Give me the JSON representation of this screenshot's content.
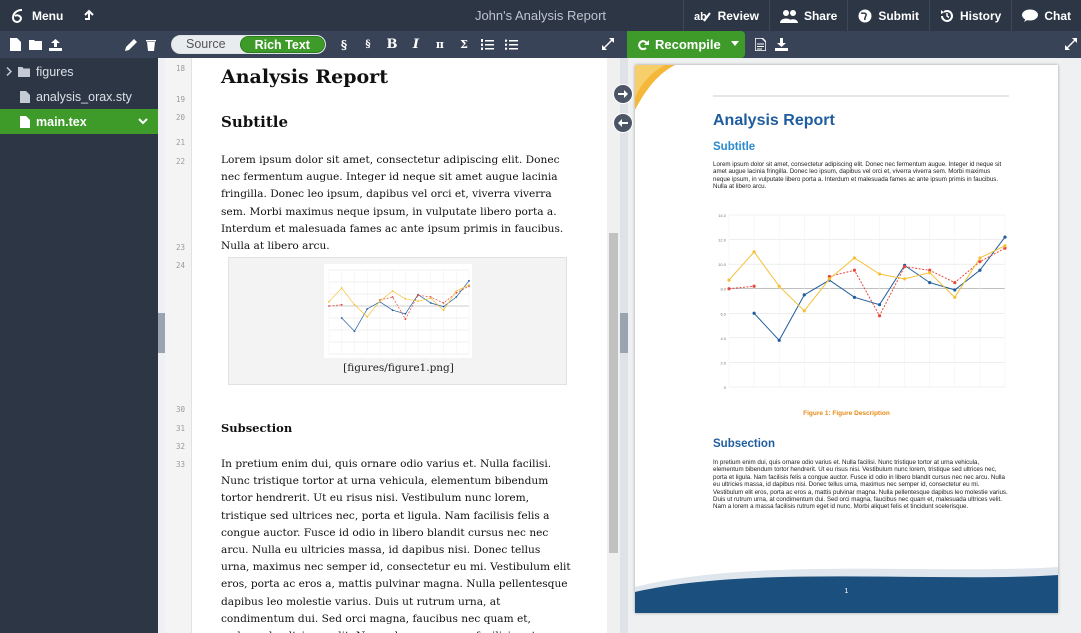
{
  "topbar": {
    "menu_label": "Menu",
    "title": "John's Analysis Report",
    "review_label": "Review",
    "share_label": "Share",
    "submit_label": "Submit",
    "history_label": "History",
    "chat_label": "Chat"
  },
  "toolbar": {
    "mode_source": "Source",
    "mode_rich": "Rich Text",
    "recompile_label": "Recompile"
  },
  "files": [
    {
      "name": "figures",
      "type": "folder"
    },
    {
      "name": "analysis_orax.sty",
      "type": "file"
    },
    {
      "name": "main.tex",
      "type": "file",
      "selected": true
    }
  ],
  "editor": {
    "line_numbers": {
      "title": "18",
      "blank_a": "19",
      "subtitle": "20",
      "blank_b": "21",
      "para1": "22",
      "blank_c": "23",
      "figure": "24",
      "blank_d": "30",
      "subsection": "31",
      "blank_e": "32",
      "para2": "33"
    },
    "title": "Analysis Report",
    "subtitle": "Subtitle",
    "para1": "Lorem ipsum dolor sit amet, consectetur adipiscing elit. Donec nec fermentum augue. Integer id neque sit amet augue lacinia fringilla. Donec leo ipsum, dapibus vel orci et, viverra viverra sem. Morbi maximus neque ipsum, in vulputate libero porta a. Interdum et malesuada fames ac ante ipsum primis in faucibus. Nulla at libero arcu.",
    "figure_path": "[figures/figure1.png]",
    "subsection": "Subsection",
    "para2": "In pretium enim dui, quis ornare odio varius et. Nulla facilisi. Nunc tristique tortor at urna vehicula, elementum bibendum tortor hendrerit. Ut eu risus nisi. Vestibulum nunc lorem, tristique sed ultrices nec, porta et ligula. Nam facilisis felis a congue auctor. Fusce id odio in libero blandit cursus nec nec arcu. Nulla eu ultricies massa, id dapibus nisi. Donec tellus urna, maximus nec semper id, consectetur eu mi. Vestibulum elit eros, porta ac eros a, mattis pulvinar magna. Nulla pellentesque dapibus leo molestie varius. Duis ut rutrum urna, at condimentum dui. Sed orci magna, faucibus nec quam et, malesuada ultrices velit. Nam a lorem a massa facilisis rutrum eget id nunc. Morbi"
  },
  "preview": {
    "title": "Analysis Report",
    "subtitle": "Subtitle",
    "para1": "Lorem ipsum dolor sit amet, consectetur adipiscing elit. Donec nec fermentum augue. Integer id neque sit amet augue lacinia fringilla. Donec leo ipsum, dapibus vel orci et, viverra viverra sem. Morbi maximus neque ipsum, in vulputate libero porta a. Interdum et malesuada fames ac ante ipsum primis in faucibus. Nulla at libero arcu.",
    "figure_caption": "Figure 1: Figure Description",
    "subsection": "Subsection",
    "para2": "In pretium enim dui, quis ornare odio varius et. Nulla facilisi. Nunc tristique tortor at urna vehicula, elementum bibendum tortor hendrerit. Ut eu risus nisi. Vestibulum nunc lorem, tristique sed ultrices nec, porta et ligula. Nam facilisis felis a congue auctor. Fusce id odio in libero blandit cursus nec nec arcu. Nulla eu ultricies massa, id dapibus nisi. Donec tellus urna, maximus nec semper id, consectetur eu mi. Vestibulum elit eros, porta ac eros a, mattis pulvinar magna. Nulla pellentesque dapibus leo molestie varius. Duis ut rutrum urna, at condimentum dui. Sed orci magna, faucibus nec quam et, malesuada ultrices velit. Nam a lorem a massa facilisis rutrum eget id nunc. Morbi aliquet felis et tincidunt scelerisque.",
    "page_number": "1"
  },
  "colors": {
    "accent_green": "#3e9b2a",
    "dark_bar": "#2c3645",
    "pdf_blue": "#1f5d9e",
    "pdf_orange": "#e58b16"
  },
  "chart_data": {
    "type": "line",
    "x": [
      1,
      2,
      3,
      4,
      5,
      6,
      7,
      8,
      9,
      10,
      11
    ],
    "ylim": [
      0,
      14
    ],
    "y_ticks": [
      "0",
      "2.0",
      "4.0",
      "6.0",
      "8.0",
      "10.0",
      "12.0",
      "14.0"
    ],
    "series": [
      {
        "color": "#1f5d9e",
        "values": [
          null,
          6.0,
          3.8,
          7.5,
          8.7,
          7.3,
          6.7,
          9.9,
          8.5,
          7.9,
          9.5,
          12.2
        ]
      },
      {
        "color": "#e8483c",
        "values": [
          8.0,
          8.2,
          null,
          null,
          9.0,
          9.5,
          5.8,
          9.8,
          9.5,
          8.5,
          10.2,
          11.3
        ]
      },
      {
        "color": "#f5c037",
        "values": [
          8.7,
          11.0,
          8.2,
          6.2,
          8.8,
          10.5,
          9.2,
          8.8,
          9.3,
          7.3,
          10.5,
          11.5
        ]
      }
    ]
  }
}
